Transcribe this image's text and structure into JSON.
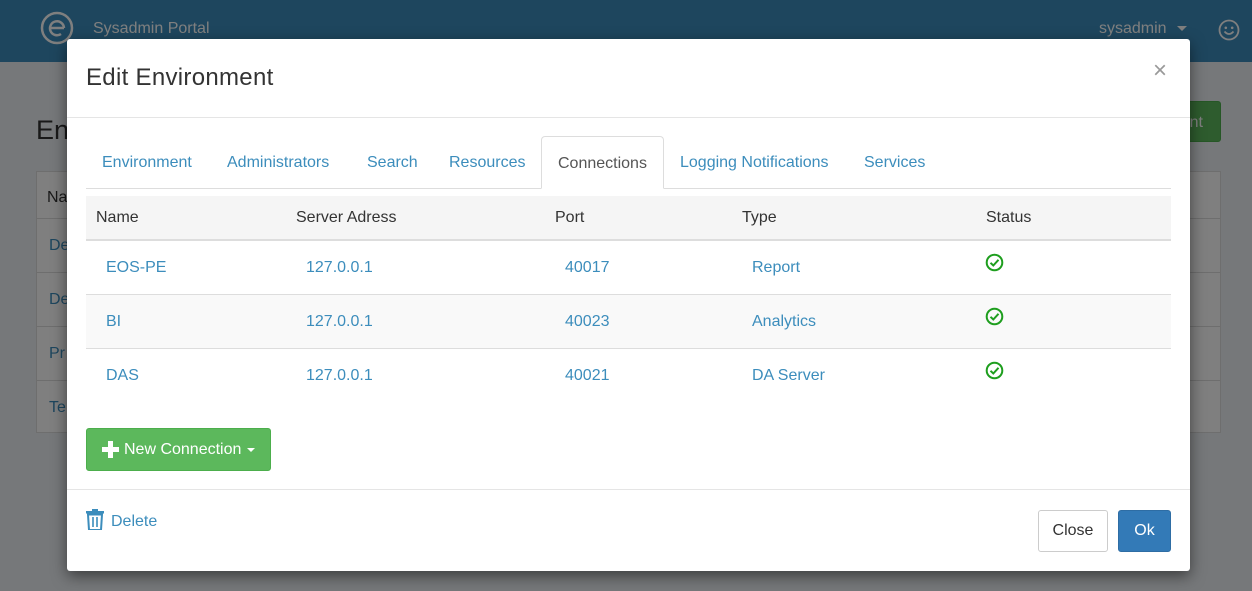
{
  "navbar": {
    "brand": "Sysadmin Portal",
    "user": "sysadmin"
  },
  "background": {
    "page_title": "En",
    "add_button": "nt",
    "table_header": "Na",
    "rows": [
      "De",
      "De",
      "Pr",
      "Te"
    ]
  },
  "modal": {
    "title": "Edit Environment",
    "close_symbol": "×",
    "tabs": [
      {
        "label": "Environment",
        "active": false
      },
      {
        "label": "Administrators",
        "active": false
      },
      {
        "label": "Search",
        "active": false
      },
      {
        "label": "Resources",
        "active": false
      },
      {
        "label": "Connections",
        "active": true
      },
      {
        "label": "Logging Notifications",
        "active": false
      },
      {
        "label": "Services",
        "active": false
      }
    ],
    "table": {
      "headers": [
        "Name",
        "Server Adress",
        "Port",
        "Type",
        "Status"
      ],
      "rows": [
        {
          "name": "EOS-PE",
          "server": "127.0.0.1",
          "port": "40017",
          "type": "Report",
          "status": "ok"
        },
        {
          "name": "BI",
          "server": "127.0.0.1",
          "port": "40023",
          "type": "Analytics",
          "status": "ok"
        },
        {
          "name": "DAS",
          "server": "127.0.0.1",
          "port": "40021",
          "type": "DA Server",
          "status": "ok"
        }
      ]
    },
    "new_connection_label": "New Connection",
    "footer": {
      "delete_label": "Delete",
      "close_label": "Close",
      "ok_label": "Ok"
    }
  },
  "colors": {
    "primary": "#337ab7",
    "link": "#3c8dbc",
    "success": "#5cb85c",
    "status_ok": "#1e9e1e"
  },
  "icons": {
    "logo": "brand-logo-icon",
    "user_menu": "smile-icon",
    "status": "check-circle-icon",
    "new_connection": "plus-icon",
    "delete": "trash-icon"
  }
}
